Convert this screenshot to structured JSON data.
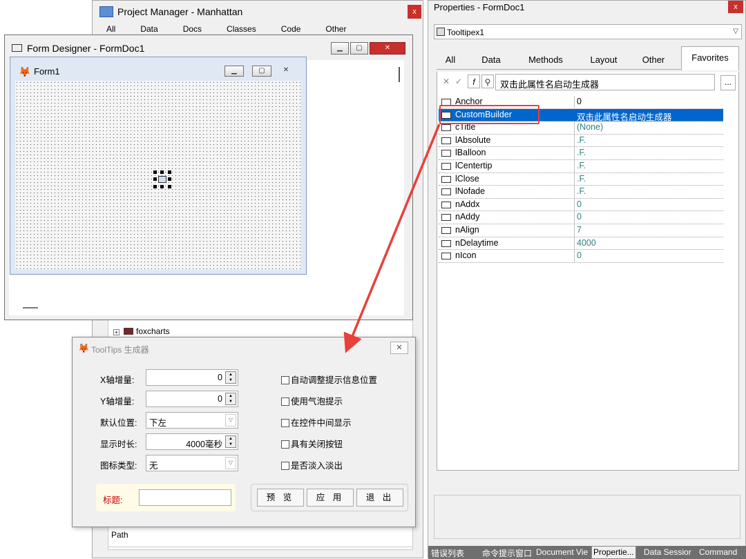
{
  "project_manager": {
    "title": "Project Manager - Manhattan",
    "close_label": "x",
    "tabs": [
      "All",
      "Data",
      "Docs",
      "Classes",
      "Code",
      "Other"
    ],
    "tree_item": "foxcharts",
    "path_label": "Path"
  },
  "form_designer": {
    "title": "Form Designer - FormDoc1",
    "form": {
      "title": "Form1"
    }
  },
  "properties": {
    "title": "Properties - FormDoc1",
    "close_label": "x",
    "object": "Tooltipex1",
    "tabs": [
      "All",
      "Data",
      "Methods",
      "Layout",
      "Other",
      "Favorites"
    ],
    "selected_tab": "Favorites",
    "value_edit": "双击此属性名启动生成器",
    "more_label": "...",
    "rows": [
      {
        "name": "Anchor",
        "value": "0"
      },
      {
        "name": "CustomBuilder",
        "value": "双击此属性名启动生成器"
      },
      {
        "name": "cTitle",
        "value": "(None)"
      },
      {
        "name": "lAbsolute",
        "value": ".F."
      },
      {
        "name": "lBalloon",
        "value": ".F."
      },
      {
        "name": "lCentertip",
        "value": ".F."
      },
      {
        "name": "lClose",
        "value": ".F."
      },
      {
        "name": "lNofade",
        "value": ".F."
      },
      {
        "name": "nAddx",
        "value": "0"
      },
      {
        "name": "nAddy",
        "value": "0"
      },
      {
        "name": "nAlign",
        "value": "7"
      },
      {
        "name": "nDelaytime",
        "value": "4000"
      },
      {
        "name": "nIcon",
        "value": "0"
      }
    ],
    "bottom_tabs": [
      "错误列表",
      "命令提示窗口",
      "Document View",
      "Properties",
      "Data Session",
      "Command"
    ],
    "bottom_tabs_display": [
      "错误列表",
      "命令提示窗口",
      "Document Vie",
      "Propertie...",
      "Data Sessior",
      "Command"
    ]
  },
  "tooltips_dialog": {
    "title": "ToolTips 生成器",
    "close_label": "✕",
    "x_inc_label": "X轴增量:",
    "x_inc_value": "0",
    "y_inc_label": "Y轴增量:",
    "y_inc_value": "0",
    "pos_label": "默认位置:",
    "pos_value": "下左",
    "delay_label": "显示时长:",
    "delay_value": "4000毫秒",
    "icon_label": "图标类型:",
    "icon_value": "无",
    "checkboxes": [
      "自动调整提示信息位置",
      "使用气泡提示",
      "在控件中间显示",
      "具有关闭按钮",
      "是否淡入淡出"
    ],
    "title_label": "标题:",
    "title_value": "",
    "buttons": [
      "预 览",
      "应 用",
      "退 出"
    ]
  },
  "annotation": {
    "color": "#e8403a"
  }
}
